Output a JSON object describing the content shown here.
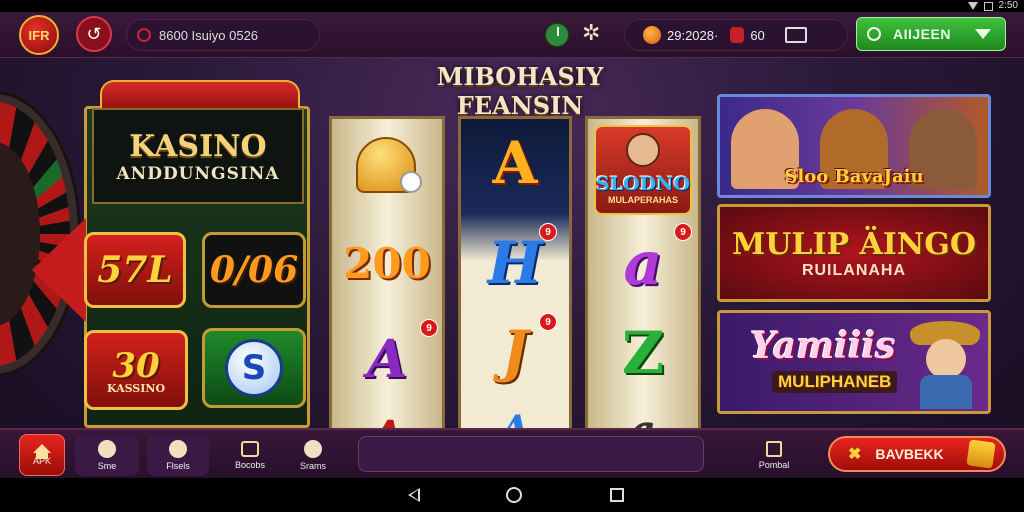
{
  "status_bar": {
    "time": "2:50"
  },
  "topbar": {
    "logo_text": "IFR",
    "user_pill_text": "8600 Isuiyo  0526",
    "coins_text": "29:2028·",
    "bag_count": "60",
    "join_label": "AIIJEEN"
  },
  "banner_title": "MIBOHASIY FEANSIN",
  "kasino": {
    "title": "KASINO",
    "subtitle": "ANDDUNGSINA",
    "tile_a": "57L",
    "tile_b": "0/06",
    "tile_c_number": "30",
    "tile_c_label": "KASSINO",
    "tile_d": "S"
  },
  "reels": {
    "reel1_mid": "200",
    "reel1_low": "A",
    "reel2_top": "A",
    "reel2_mid": "H",
    "reel2_low": "J",
    "reel3_logo_title": "SLODNO",
    "reel3_logo_sub": "MULAPERAHAS",
    "reel3_mid": "a",
    "reel3_low": "Z",
    "badge_9": "9"
  },
  "promos": {
    "card1_label": "Sloo  BavaJaiu",
    "card2_title": "MULIP ÄINGO",
    "card2_sub": "RUILANAHA",
    "card3_title": "Yamiiis",
    "card3_sub": "MULIPHANEB"
  },
  "bottom_nav": {
    "home_label": "APK",
    "item2_label": "Sme",
    "item3_label": "Flsels",
    "item4_label": "Bocobs",
    "item5_label": "Srams",
    "gift_label": "Pombal",
    "bonus_label": "BAVBEKK"
  },
  "colors": {
    "accent_red": "#d81a1a",
    "accent_green": "#2fae2c",
    "gold": "#f0c040",
    "background_purple": "#2a1a3a"
  }
}
